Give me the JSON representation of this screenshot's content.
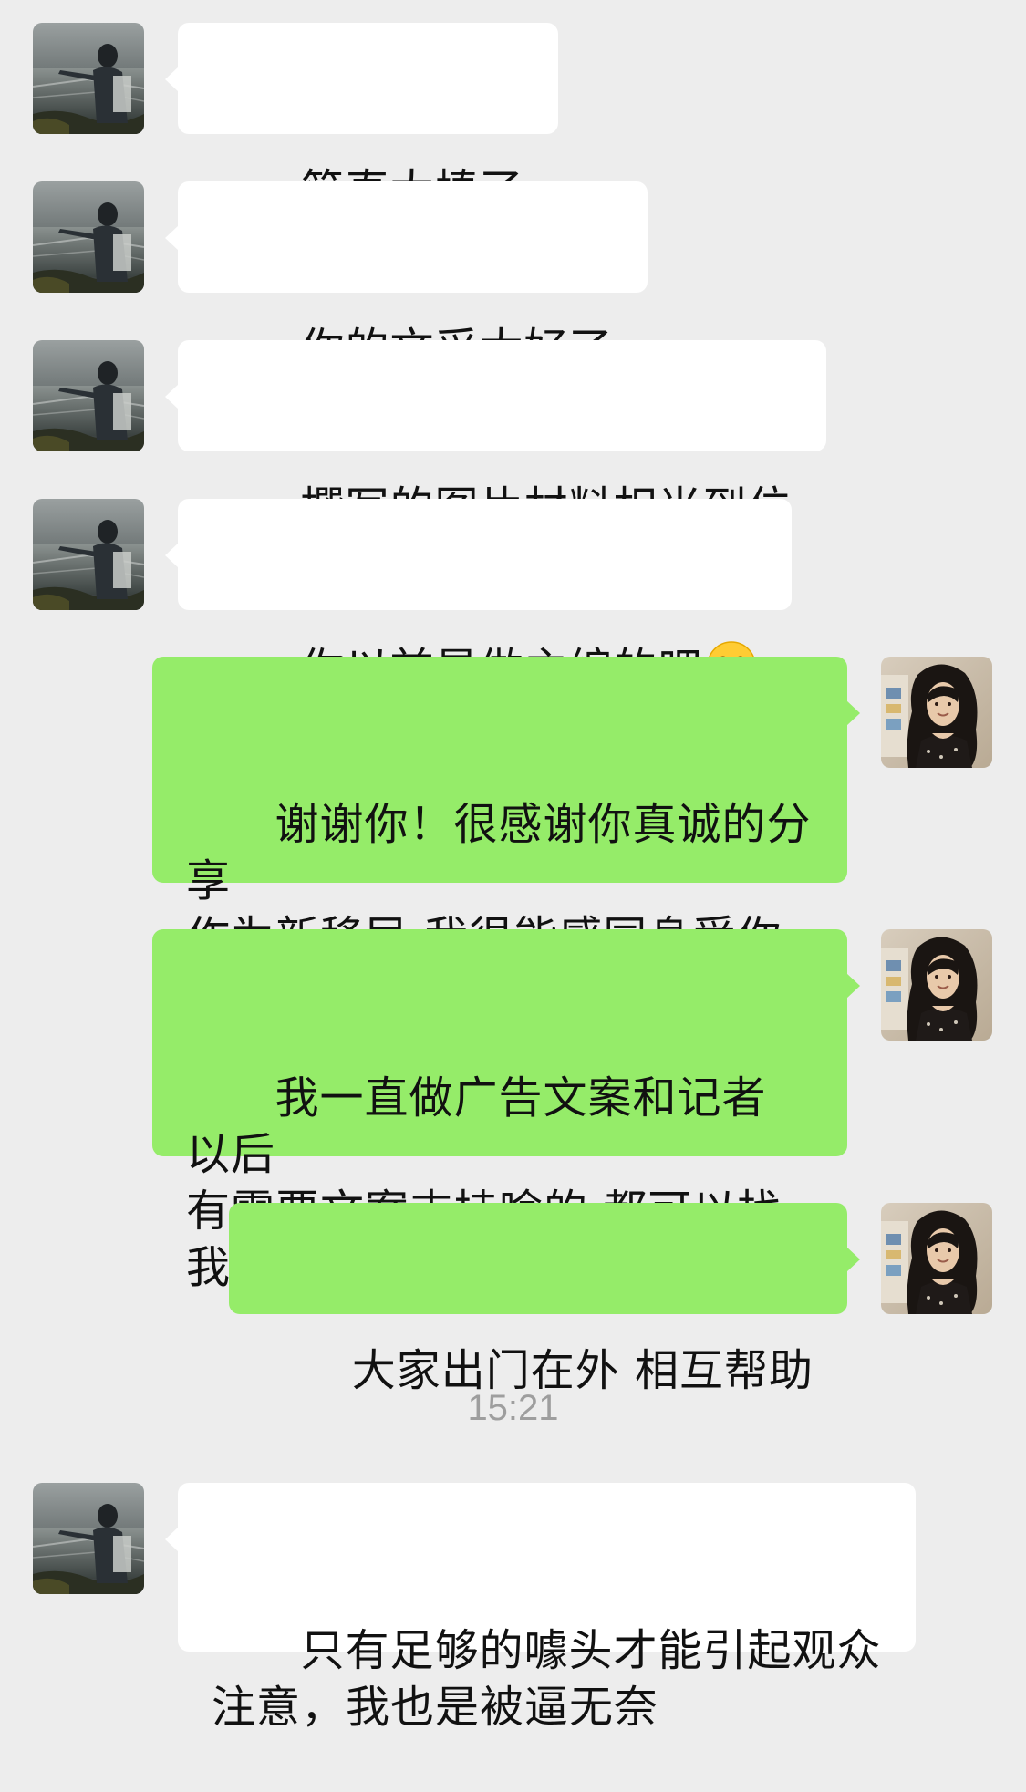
{
  "conversation": {
    "messages": [
      {
        "side": "in",
        "text": "简直太棒了"
      },
      {
        "side": "in",
        "text": "你的文采太好了"
      },
      {
        "side": "in",
        "text": "撰写的图片材料相当到位"
      },
      {
        "side": "in",
        "text": "你以前是做主编的吧",
        "emoji": "laughing-crying-emoji"
      },
      {
        "side": "out",
        "text": "谢谢你！很感谢你真诚的分享\n作为新移民 我很能感同身受你\n的故事"
      },
      {
        "side": "out",
        "text": "我一直做广告文案和记者 以后\n有需要文案支持啥的 都可以找\n我"
      },
      {
        "side": "out",
        "text": "大家出门在外 相互帮助"
      },
      {
        "side": "in",
        "text": "只有足够的噱头才能引起观众\n注意，我也是被逼无奈"
      }
    ],
    "timestamp": "15:21"
  },
  "colors": {
    "background": "#ededed",
    "incoming_bubble": "#ffffff",
    "outgoing_bubble": "#95ec69",
    "timestamp_text": "#9e9e9e"
  },
  "icons": {
    "contact_avatar": "landscape-person-avatar",
    "self_avatar": "woman-portrait-avatar"
  }
}
